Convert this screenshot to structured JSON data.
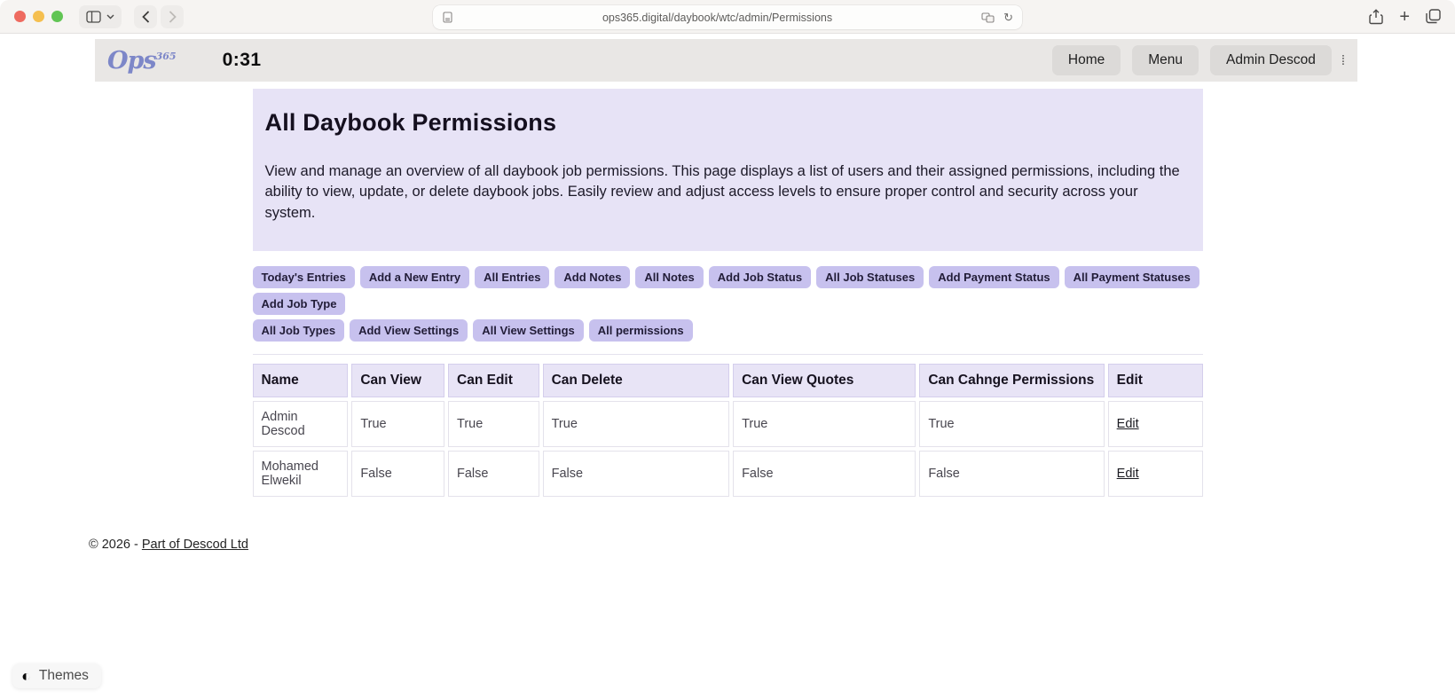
{
  "browser": {
    "url": "ops365.digital/daybook/wtc/admin/Permissions",
    "icons": {
      "plus": "+",
      "reload": "↻"
    }
  },
  "header": {
    "logo_text": "Ops",
    "logo_sup": "365",
    "timer": "0:31",
    "nav": [
      {
        "label": "Home"
      },
      {
        "label": "Menu"
      },
      {
        "label": "Admin Descod"
      }
    ],
    "kebab_glyph": "⁞"
  },
  "page": {
    "title": "All Daybook Permissions",
    "description": "View and manage an overview of all daybook job permissions. This page displays a list of users and their assigned permissions, including the ability to view, update, or delete daybook jobs. Easily review and adjust access levels to ensure proper control and security across your system.",
    "actions_row1": [
      "Today's Entries",
      "Add a New Entry",
      "All Entries",
      "Add Notes",
      "All Notes",
      "Add Job Status",
      "All Job Statuses",
      "Add Payment Status",
      "All Payment Statuses",
      "Add Job Type"
    ],
    "actions_row2": [
      "All Job Types",
      "Add View Settings",
      "All View Settings",
      "All permissions"
    ]
  },
  "table": {
    "columns": [
      "Name",
      "Can View",
      "Can Edit",
      "Can Delete",
      "Can View Quotes",
      "Can Cahnge Permissions",
      "Edit"
    ],
    "rows": [
      {
        "cells": [
          "Admin Descod",
          "True",
          "True",
          "True",
          "True",
          "True"
        ],
        "edit_label": "Edit"
      },
      {
        "cells": [
          "Mohamed Elwekil",
          "False",
          "False",
          "False",
          "False",
          "False"
        ],
        "edit_label": "Edit"
      }
    ]
  },
  "footer": {
    "copyright": "© 2026 - ",
    "link": "Part of Descod Ltd"
  },
  "themes": {
    "label": "Themes",
    "icon_glyph": "◐"
  },
  "colors": {
    "accent_pill": "#c7c1ee",
    "panel_lavender": "#e7e3f6",
    "header_gray": "#e9e7e5",
    "logo_purple": "#7d87c8",
    "traffic_red": "#ee6a5f",
    "traffic_yellow": "#f5bf4f",
    "traffic_green": "#61c554"
  }
}
